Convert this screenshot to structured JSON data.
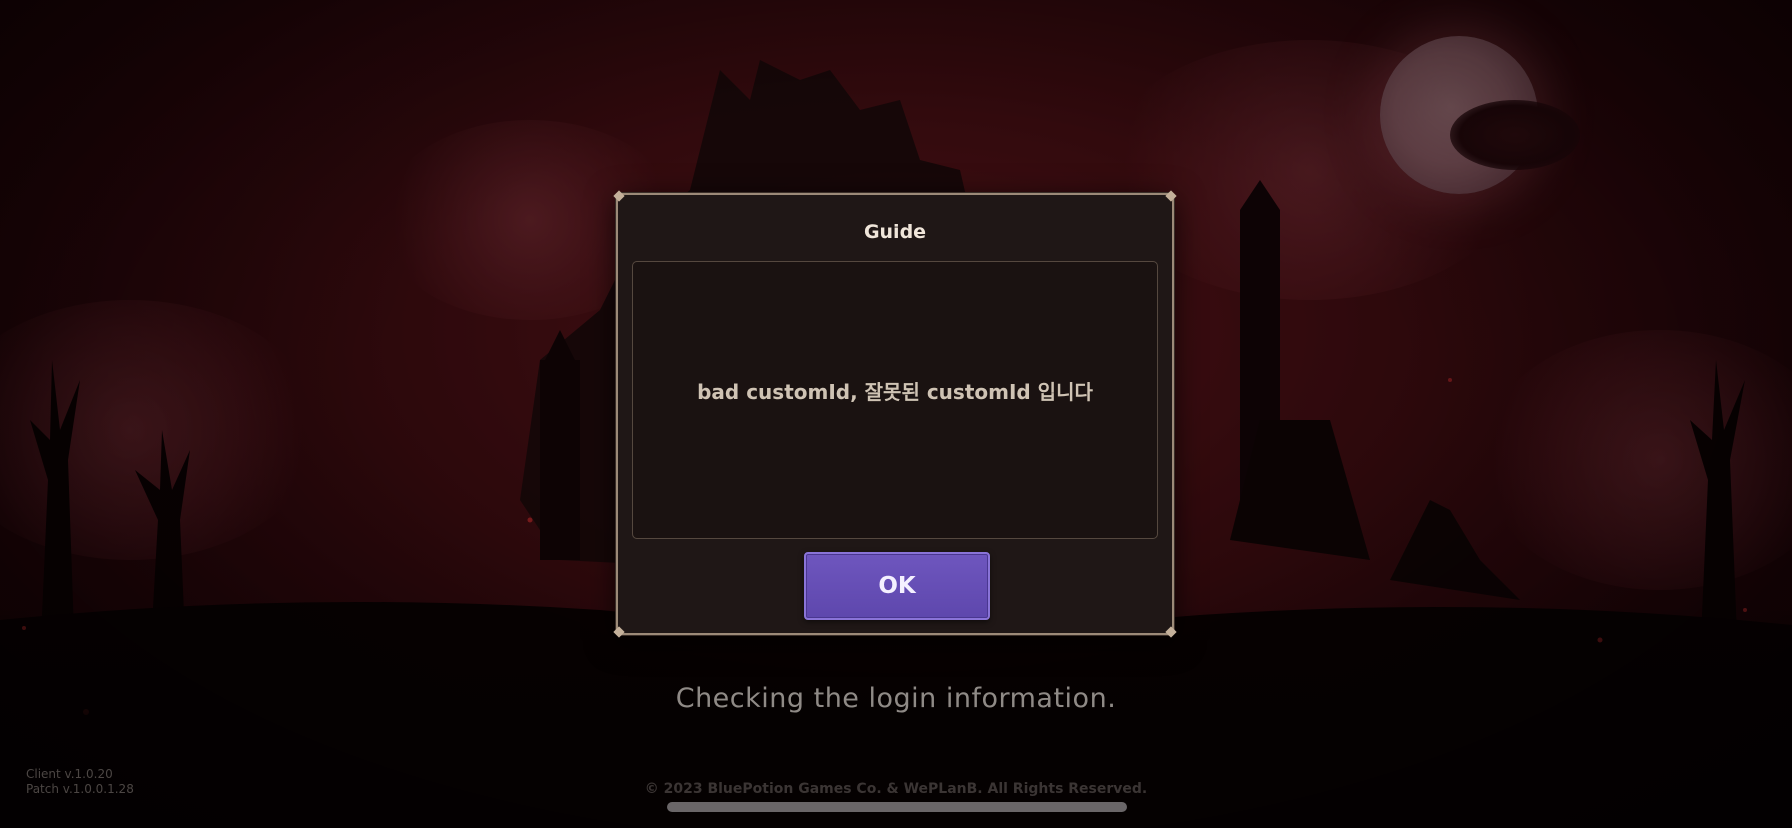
{
  "dialog": {
    "title": "Guide",
    "message": "bad customId, 잘못된 customId 입니다",
    "ok_label": "OK"
  },
  "status": {
    "text": "Checking the login information."
  },
  "footer": {
    "client_version": "Client v.1.0.20",
    "patch_version": "Patch v.1.0.0.1.28",
    "copyright": "© 2023 BluePotion Games Co. & WePLanB. All Rights Reserved."
  },
  "colors": {
    "ok_button": "#5e47ad",
    "dialog_bg": "#1f1716",
    "dialog_border": "#9c8a78"
  }
}
